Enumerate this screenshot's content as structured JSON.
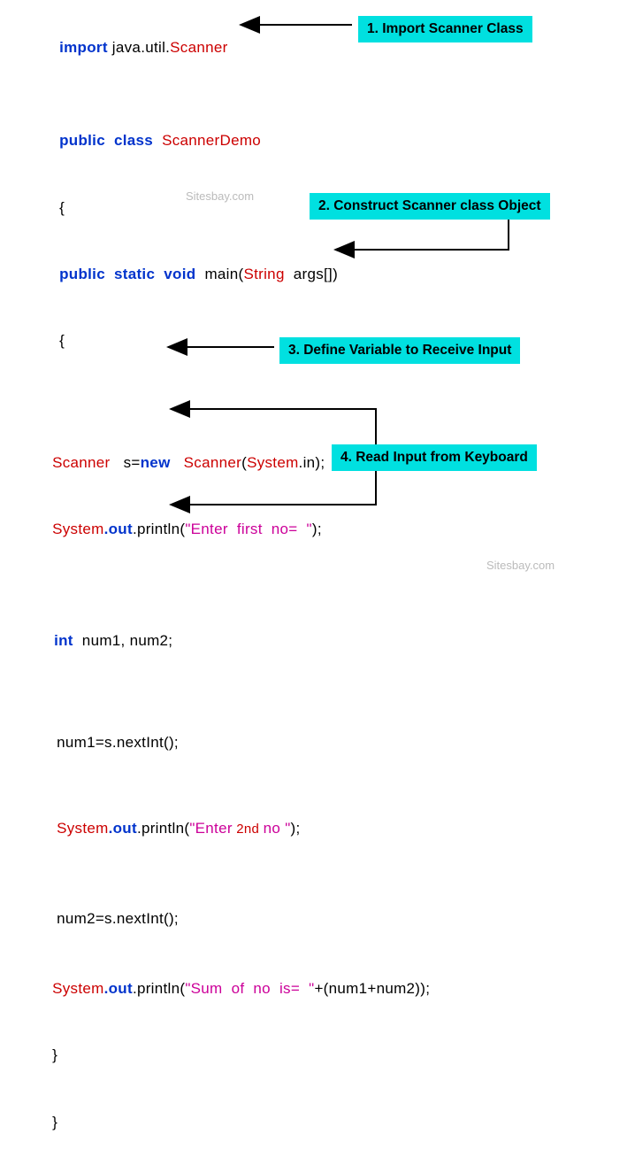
{
  "code": {
    "l1_import": "import",
    "l1_pkg": " java.util.",
    "l1_scanner": "Scanner",
    "l2_public": "public",
    "l2_class": "  class",
    "l2_name": "  ScannerDemo",
    "l3_brace": "{",
    "l4_public": "public",
    "l4_static": "  static",
    "l4_void": "  void",
    "l4_main": "  main(",
    "l4_string": "String",
    "l4_args": "  args[])",
    "l5_brace": "{",
    "l6_scanner": "Scanner",
    "l6_decl": "   s=",
    "l6_new": "new",
    "l6_ctor": "   Scanner",
    "l6_sysin_open": "(",
    "l6_system": "System",
    "l6_in": ".in",
    "l6_close": ");",
    "l7_sys": "System",
    "l7_out": ".out",
    "l7_println": ".println(",
    "l7_str": "\"Enter  first  no=  \"",
    "l7_close": ");",
    "l8_int": "int",
    "l8_vars": "  num1, num2;",
    "l9_nextint1": "num1=s.nextInt();",
    "l10_sys": "System",
    "l10_out": ".out",
    "l10_println": ".println(",
    "l10_str1": "\"Enter",
    "l10_str2": " 2nd ",
    "l10_str3": "no \"",
    "l10_close": ");",
    "l11_nextint2": "num2=s.nextInt();",
    "l12_sys": "System",
    "l12_out": ".out",
    "l12_println": ".println(",
    "l12_str": "\"Sum  of  no  is=  \"",
    "l12_rest": "+(num1+num2));",
    "l13_brace": "}",
    "l14_brace": "}"
  },
  "callouts": {
    "c1": "1. Import Scanner Class",
    "c2": "2. Construct Scanner class Object",
    "c3": "3. Define Variable to Receive Input",
    "c4": "4. Read Input from Keyboard"
  },
  "watermark": "Sitesbay.com"
}
